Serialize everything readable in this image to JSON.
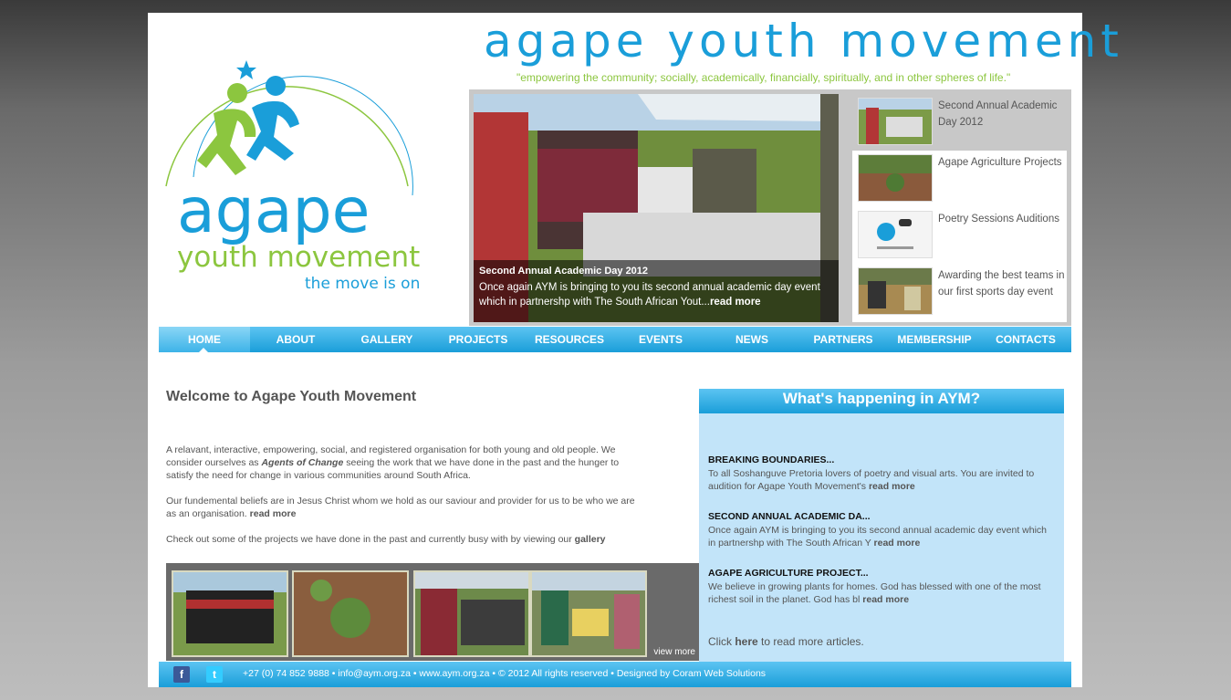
{
  "header": {
    "site_title": "agape youth movement",
    "tagline": "\"empowering the community; socially, academically, financially, spiritually, and in other spheres of life.\"",
    "logo": {
      "word": "agape",
      "sub": "youth movement",
      "motto": "the move is on"
    }
  },
  "slider": {
    "caption_title": "Second Annual Academic Day 2012",
    "caption_text": "Once again AYM is bringing to you its second annual academic day event which in partnershp with The South African Yout...",
    "caption_link": "read more",
    "items": [
      {
        "label": "Second Annual Academic Day 2012"
      },
      {
        "label": "Agape Agriculture Projects"
      },
      {
        "label": "Poetry Sessions Auditions"
      },
      {
        "label": "Awarding the best teams in our first sports day event"
      }
    ]
  },
  "nav": {
    "items": [
      {
        "label": "HOME"
      },
      {
        "label": "ABOUT"
      },
      {
        "label": "GALLERY"
      },
      {
        "label": "PROJECTS"
      },
      {
        "label": "RESOURCES"
      },
      {
        "label": "EVENTS"
      },
      {
        "label": "NEWS"
      },
      {
        "label": "PARTNERS"
      },
      {
        "label": "MEMBERSHIP"
      },
      {
        "label": "CONTACTS"
      }
    ]
  },
  "main": {
    "title": "Welcome to Agape Youth Movement",
    "p1_a": "A relavant, interactive, empowering, social, and registered organisation for both young and old people. We consider ourselves as ",
    "p1_em": "Agents of Change",
    "p1_b": " seeing the work that we have done in the past and the hunger to satisfy the need for change in various communities around South Africa.",
    "p2": "Our fundemental beliefs are in Jesus Christ whom we hold as our saviour and provider for us to be who we are as an organisation.",
    "p2_link": "read more",
    "p3": "Check out some of the projects we have done in the past and currently busy with by viewing our",
    "p3_link": "gallery",
    "view_more": "view more"
  },
  "news": {
    "header": "What's happening in AYM?",
    "items": [
      {
        "title": "BREAKING BOUNDARIES...",
        "body": "To all Soshanguve Pretoria lovers of poetry and visual arts. You are invited to audition for Agape Youth Movement's",
        "link": "read more"
      },
      {
        "title": "SECOND ANNUAL ACADEMIC DA...",
        "body": "Once again AYM is bringing to you its second annual academic day event which in partnershp with The South African Y",
        "link": "read more"
      },
      {
        "title": "AGAPE AGRICULTURE PROJECT...",
        "body": "We believe in growing plants for homes. God has blessed with one of the most richest soil in the planet. God has bl",
        "link": "read more"
      }
    ],
    "more_prefix": "Click",
    "more_link": "here",
    "more_suffix": "to read more articles."
  },
  "footer": {
    "facebook": "f",
    "twitter": "t",
    "text": "+27 (0) 74 852 9888  •  info@aym.org.za  •  www.aym.org.za  •  © 2012 All rights reserved  •  Designed by Coram Web Solutions"
  },
  "colors": {
    "accent_blue": "#1a9ed9",
    "accent_green": "#8cc63f",
    "news_bg": "#c2e4f9"
  }
}
